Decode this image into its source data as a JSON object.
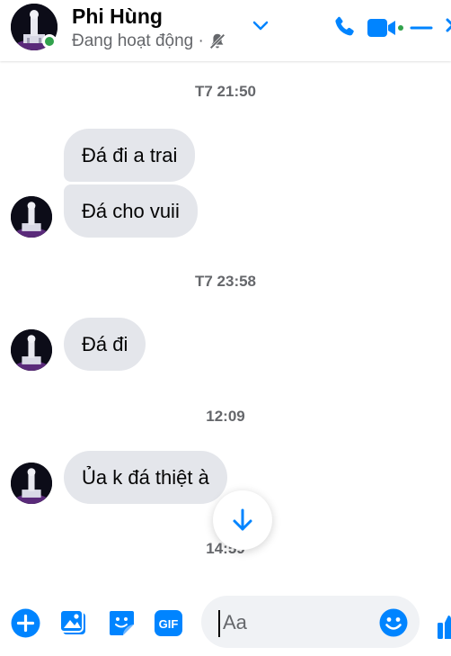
{
  "header": {
    "contact_name": "Phi Hùng",
    "status": "Đang hoạt động ·",
    "icons": [
      "chevron-down-icon",
      "phone-icon",
      "video-icon",
      "minimize-icon",
      "close-icon"
    ]
  },
  "messages": [
    {
      "type": "timestamp",
      "text": "T7 21:50"
    },
    {
      "type": "bubble",
      "text": "Đá đi a trai"
    },
    {
      "type": "bubble",
      "text": "Đá cho vuii"
    },
    {
      "type": "timestamp",
      "text": "T7 23:58"
    },
    {
      "type": "bubble",
      "text": "Đá đi"
    },
    {
      "type": "timestamp",
      "text": "12:09"
    },
    {
      "type": "bubble",
      "text": "Ủa k đá thiệt à"
    },
    {
      "type": "timestamp",
      "text": "14:59"
    }
  ],
  "composer": {
    "placeholder": "Aa",
    "icons": [
      "plus-icon",
      "image-icon",
      "sticker-icon",
      "gif-icon",
      "emoji-icon",
      "like-icon"
    ],
    "gif_label": "GIF"
  },
  "colors": {
    "accent": "#0084ff",
    "bubble": "#e4e6eb",
    "online": "#31a24c"
  }
}
